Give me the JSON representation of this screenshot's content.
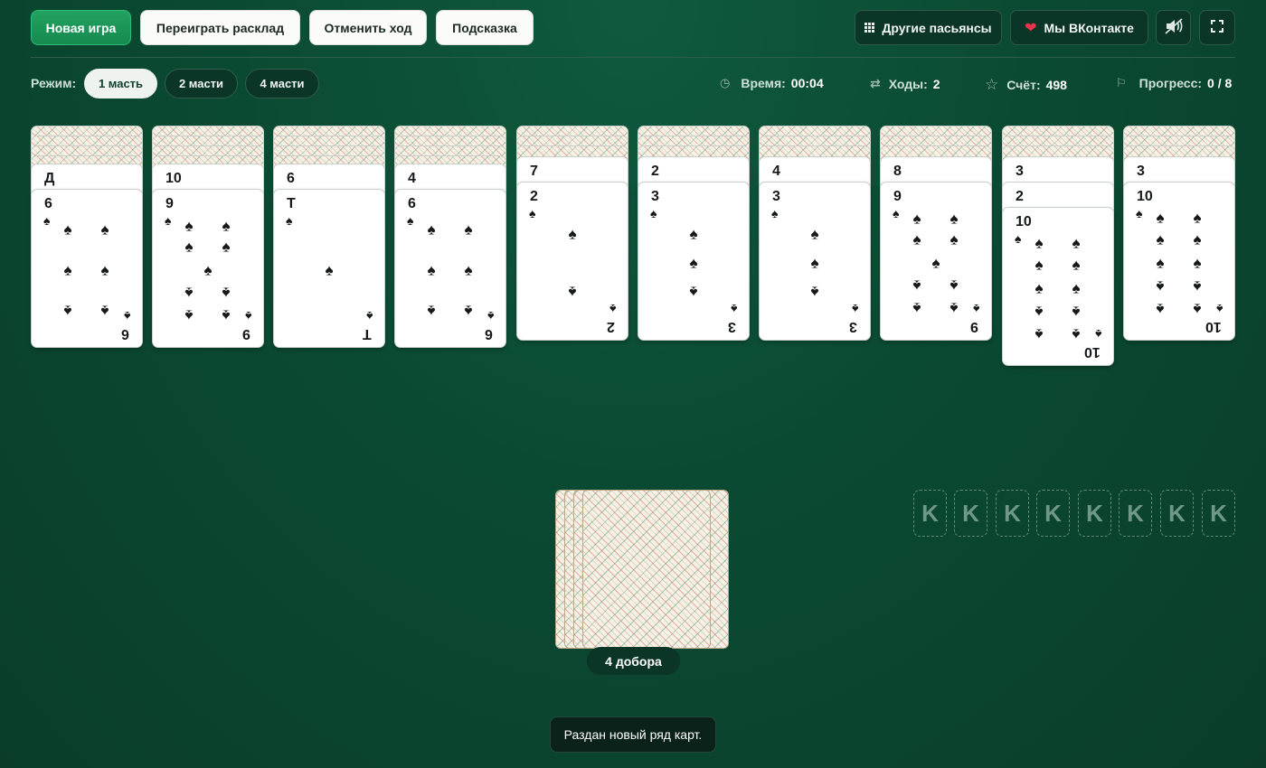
{
  "toolbar": {
    "new_game": "Новая игра",
    "replay": "Переиграть расклад",
    "undo": "Отменить ход",
    "hint": "Подсказка",
    "other_games": "Другие пасьянсы",
    "vk": "Мы ВКонтакте"
  },
  "icons": {
    "grid": "grid-icon",
    "heart": "heart-icon",
    "sound": "speaker-icon",
    "fullscreen": "fullscreen-icon"
  },
  "mode": {
    "label": "Режим:",
    "options": [
      "1 масть",
      "2 масти",
      "4 масти"
    ],
    "selected": "1 масть"
  },
  "stats": {
    "time_label": "Время:",
    "time": "00:04",
    "moves_label": "Ходы:",
    "moves": "2",
    "score_label": "Счёт:",
    "score": "498",
    "progress_label": "Прогресс:",
    "progress": "0 / 8"
  },
  "tableau": [
    {
      "hidden": 4,
      "partial": [
        "Д"
      ],
      "top": "6"
    },
    {
      "hidden": 4,
      "partial": [
        "10"
      ],
      "top": "9"
    },
    {
      "hidden": 4,
      "partial": [
        "6"
      ],
      "top": "Т"
    },
    {
      "hidden": 4,
      "partial": [
        "4"
      ],
      "top": "6"
    },
    {
      "hidden": 3,
      "partial": [
        "7"
      ],
      "top": "2"
    },
    {
      "hidden": 3,
      "partial": [
        "2"
      ],
      "top": "3"
    },
    {
      "hidden": 3,
      "partial": [
        "4"
      ],
      "top": "3"
    },
    {
      "hidden": 3,
      "partial": [
        "8"
      ],
      "top": "9"
    },
    {
      "hidden": 3,
      "partial": [
        "3",
        "2"
      ],
      "top": "10"
    },
    {
      "hidden": 3,
      "partial": [
        "3"
      ],
      "top": "10"
    }
  ],
  "suit_symbol": "♠",
  "stock": {
    "label": "4 добора"
  },
  "foundations": [
    "K",
    "K",
    "K",
    "K",
    "K",
    "K",
    "K",
    "K"
  ],
  "toast": "Раздан новый ряд карт.",
  "colors": {
    "accent": "#1e9a5a",
    "felt": "#0b4a32"
  }
}
